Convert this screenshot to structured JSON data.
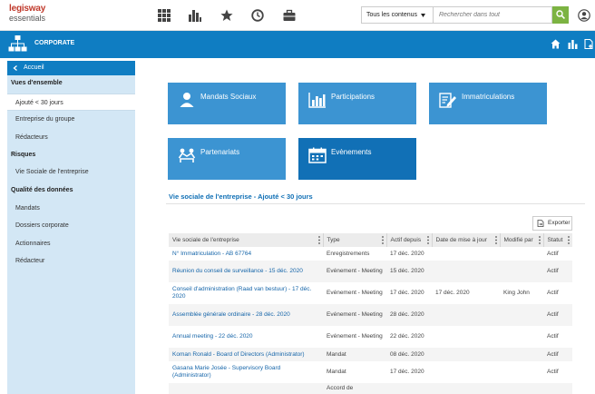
{
  "logo": {
    "line1": "legisway",
    "line2": "essentials"
  },
  "topnav": {
    "icons": [
      "grid-icon",
      "bar-chart-icon",
      "star-icon",
      "clock-icon",
      "briefcase-icon"
    ]
  },
  "search": {
    "scope": "Tous les contenus",
    "placeholder": "Rechercher dans tout"
  },
  "header": {
    "title": "CORPORATE",
    "accent": "#0f7dc2"
  },
  "sidebar": {
    "back_label": "Accueil",
    "sections": [
      {
        "title": "Vues d'ensemble",
        "items": [
          "Ajouté < 30 jours",
          "Entreprise du groupe",
          "Rédacteurs"
        ]
      },
      {
        "title": "Risques",
        "items": [
          "Vie Sociale de l'entreprise"
        ]
      },
      {
        "title": "Qualité des données",
        "items": [
          "Mandats",
          "Dossiers corporate",
          "Actionnaires",
          "Rédacteur"
        ]
      }
    ]
  },
  "tiles": [
    "Mandats Sociaux",
    "Participations",
    "Immatriculations",
    "Partenariats",
    "Evènements"
  ],
  "section_title": "Vie sociale de l'entreprise - Ajouté < 30 jours",
  "export_label": "Exporter",
  "table": {
    "headers": [
      "Vie sociale de l'entreprise",
      "Type",
      "Actif depuis",
      "Date de mise à jour",
      "Modifié par",
      "Statut"
    ],
    "rows": [
      [
        "N° Immatriculation - AB 67764",
        "Enregistrements",
        "17 déc. 2020",
        "",
        "",
        "Actif"
      ],
      [
        "Réunion du conseil de surveillance - 15 déc. 2020",
        "Evénement - Meeting",
        "15 déc. 2020",
        "",
        "",
        "Actif"
      ],
      [
        "Conseil d'administration (Raad van bestuur) - 17 déc. 2020",
        "Evénement - Meeting",
        "17 déc. 2020",
        "17 déc. 2020",
        "King John",
        "Actif"
      ],
      [
        "Assemblée générale ordinaire - 28 déc. 2020",
        "Evénement - Meeting",
        "28 déc. 2020",
        "",
        "",
        "Actif"
      ],
      [
        "Annual meeting - 22 déc. 2020",
        "Evénement - Meeting",
        "22 déc. 2020",
        "",
        "",
        "Actif"
      ],
      [
        "Koman Ronald - Board of Directors (Administrator)",
        "Mandat",
        "08 déc. 2020",
        "",
        "",
        "Actif"
      ],
      [
        "Gasana Marie Josée - Supervisory Board (Administrator)",
        "Mandat",
        "17 déc. 2020",
        "",
        "",
        "Actif"
      ],
      [
        "",
        "Accord de",
        "",
        "",
        "",
        ""
      ]
    ]
  }
}
